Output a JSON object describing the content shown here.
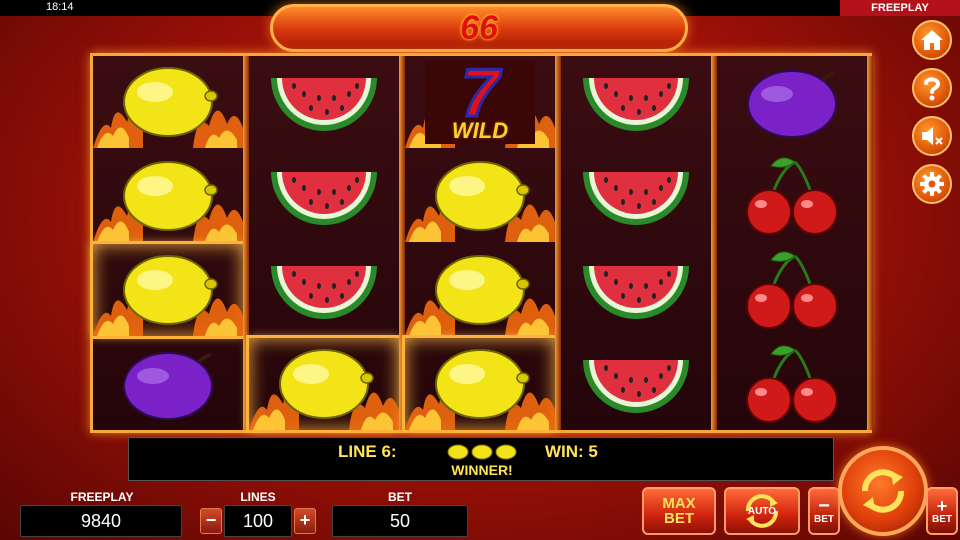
{
  "status_bar": {
    "time": "18:14",
    "mode": "FREEPLAY"
  },
  "win_banner": {
    "amount": "66"
  },
  "reels": [
    {
      "symbols": [
        "lemon",
        "lemon",
        "lemon",
        "plum"
      ],
      "highlighted": [
        false,
        false,
        true,
        false
      ],
      "fire": [
        true,
        true,
        true,
        false
      ]
    },
    {
      "symbols": [
        "watermelon",
        "watermelon",
        "watermelon",
        "lemon"
      ],
      "highlighted": [
        false,
        false,
        false,
        true
      ],
      "fire": [
        false,
        false,
        false,
        true
      ]
    },
    {
      "symbols": [
        "wild",
        "lemon",
        "lemon",
        "lemon"
      ],
      "highlighted": [
        false,
        false,
        false,
        true
      ],
      "fire": [
        true,
        true,
        true,
        true
      ]
    },
    {
      "symbols": [
        "watermelon",
        "watermelon",
        "watermelon",
        "watermelon"
      ],
      "highlighted": [
        false,
        false,
        false,
        false
      ],
      "fire": [
        false,
        false,
        false,
        false
      ]
    },
    {
      "symbols": [
        "plum",
        "cherry",
        "cherry",
        "cherry"
      ],
      "highlighted": [
        false,
        false,
        false,
        false
      ],
      "fire": [
        false,
        false,
        false,
        false
      ]
    }
  ],
  "wild_label": "WILD",
  "wild_digit": "7",
  "info": {
    "line_text": "LINE 6:",
    "win_text": "WIN: 5",
    "result": "WINNER!",
    "line_symbol_count": 3
  },
  "controls": {
    "freeplay_label": "FREEPLAY",
    "freeplay_value": "9840",
    "lines_label": "LINES",
    "lines_value": "100",
    "bet_label": "BET",
    "bet_value": "50",
    "minus": "−",
    "plus": "+",
    "max_bet_line1": "MAX",
    "max_bet_line2": "BET",
    "auto_label": "AUTO",
    "bet_minus_label": "BET",
    "bet_plus_label": "BET"
  },
  "side_buttons": [
    "home-icon",
    "help-icon",
    "sound-off-icon",
    "gear-icon"
  ],
  "colors": {
    "accent": "#ffe45a",
    "frame": "#f7a83a",
    "button": "#e2570a"
  }
}
